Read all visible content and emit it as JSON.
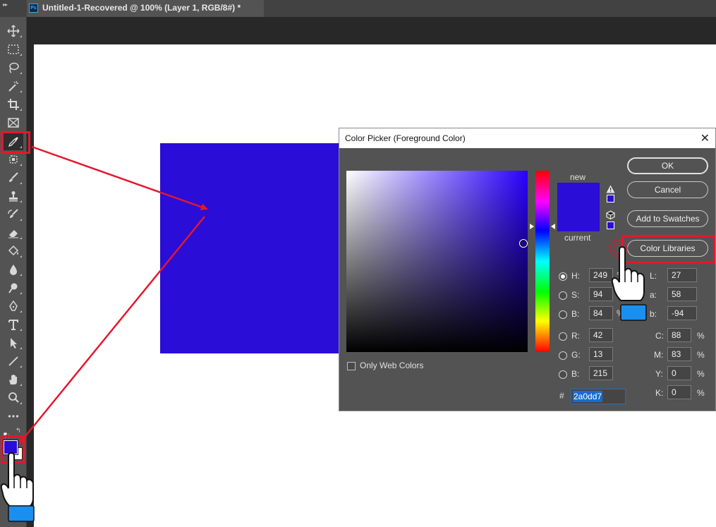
{
  "window": {
    "doc_title": "Untitled-1-Recovered @ 100% (Layer 1, RGB/8#) *",
    "app_badge": "Ps"
  },
  "toolbar": {
    "tools": [
      "move-icon",
      "marquee-icon",
      "lasso-icon",
      "magic-wand-icon",
      "crop-icon",
      "frame-icon",
      "eyedropper-icon",
      "patch-icon",
      "brush-icon",
      "stamp-icon",
      "history-brush-icon",
      "eraser-icon",
      "paint-bucket-icon",
      "blur-icon",
      "dodge-icon",
      "pen-icon",
      "type-icon",
      "path-select-icon",
      "line-icon",
      "hand-icon",
      "zoom-icon",
      "more-icon"
    ],
    "foreground_color": "#2a0dd7",
    "background_color": "#ffffff"
  },
  "dialog": {
    "title": "Color Picker (Foreground Color)",
    "close": "✕",
    "new_label": "new",
    "current_label": "current",
    "buttons": {
      "ok": "OK",
      "cancel": "Cancel",
      "add_to_swatches": "Add to Swatches",
      "color_libraries": "Color Libraries"
    },
    "only_web_colors": "Only Web Colors",
    "hsb": {
      "h_label": "H:",
      "h": "249",
      "h_unit": "°",
      "s_label": "S:",
      "s": "94",
      "s_unit": "%",
      "b_label": "B:",
      "b": "84",
      "b_unit": "%"
    },
    "rgb": {
      "r_label": "R:",
      "r": "42",
      "g_label": "G:",
      "g": "13",
      "b_label": "B:",
      "b": "215"
    },
    "lab": {
      "l_label": "L:",
      "l": "27",
      "a_label": "a:",
      "a": "58",
      "b_label": "b:",
      "b": "-94"
    },
    "cmyk": {
      "c_label": "C:",
      "c": "88",
      "m_label": "M:",
      "m": "83",
      "y_label": "Y:",
      "y": "0",
      "k_label": "K:",
      "k": "0",
      "unit": "%"
    },
    "hex_label": "#",
    "hex": "2a0dd7",
    "color": "#2a0dd7"
  },
  "colors": {
    "highlight": "#e5162d",
    "hand_tip": "#1a8ff0"
  }
}
